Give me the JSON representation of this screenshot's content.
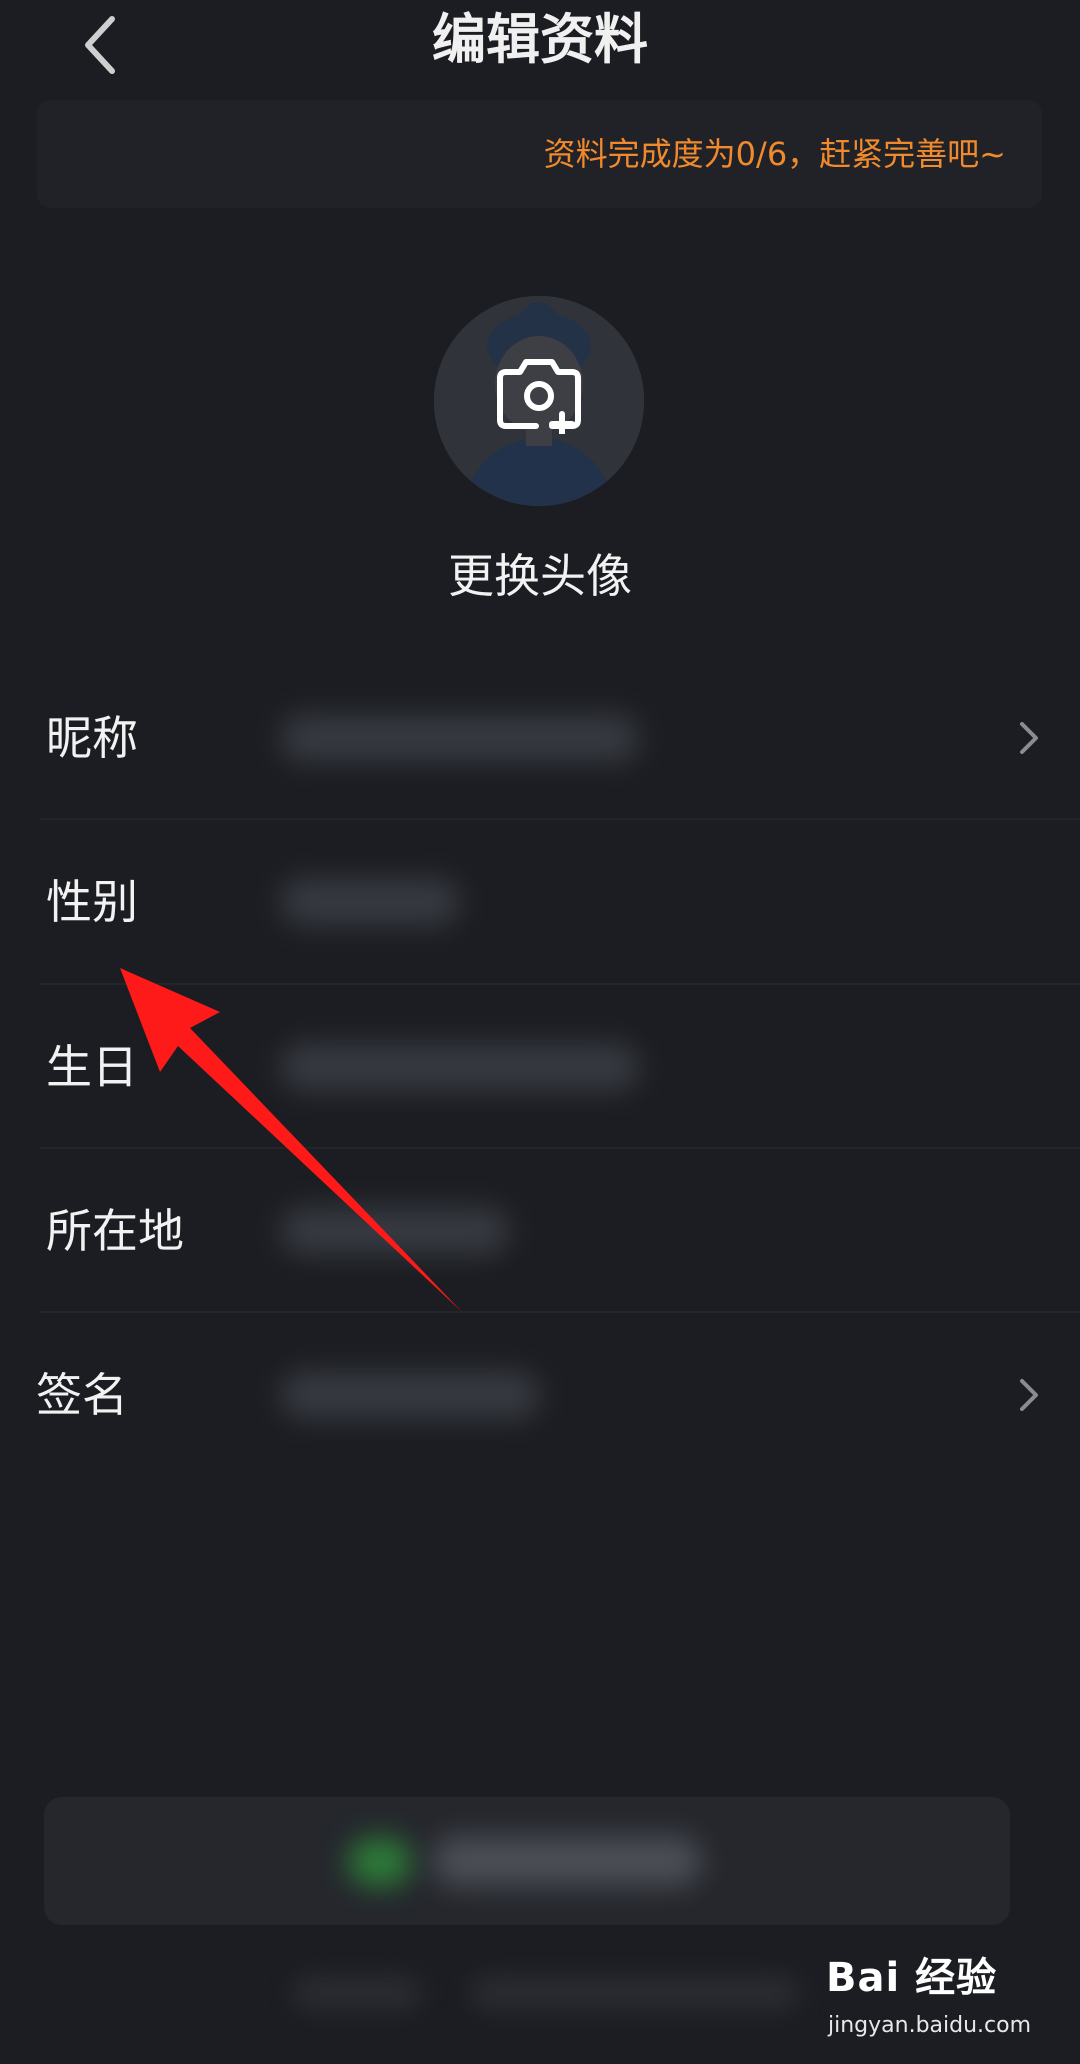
{
  "header": {
    "title": "编辑资料",
    "back_icon": "chevron-left-icon"
  },
  "banner": {
    "text": "资料完成度为0/6，赶紧完善吧~",
    "color": "#f08a2c"
  },
  "avatar": {
    "icon": "camera-add-icon",
    "label": "更换头像"
  },
  "profile_rows": [
    {
      "label": "昵称",
      "has_chevron": true
    },
    {
      "label": "性别",
      "has_chevron": false
    },
    {
      "label": "生日",
      "has_chevron": false
    },
    {
      "label": "所在地",
      "has_chevron": false
    },
    {
      "label": "签名",
      "has_chevron": true
    }
  ],
  "annotation": {
    "arrow_color": "#ff1a1a",
    "points_to": "性别"
  },
  "watermark": {
    "main": "Bai 经验",
    "sub": "jingyan.baidu.com"
  },
  "colors": {
    "background": "#1b1d22",
    "card": "#202227",
    "text": "#f2f2f2",
    "accent": "#f08a2c"
  }
}
